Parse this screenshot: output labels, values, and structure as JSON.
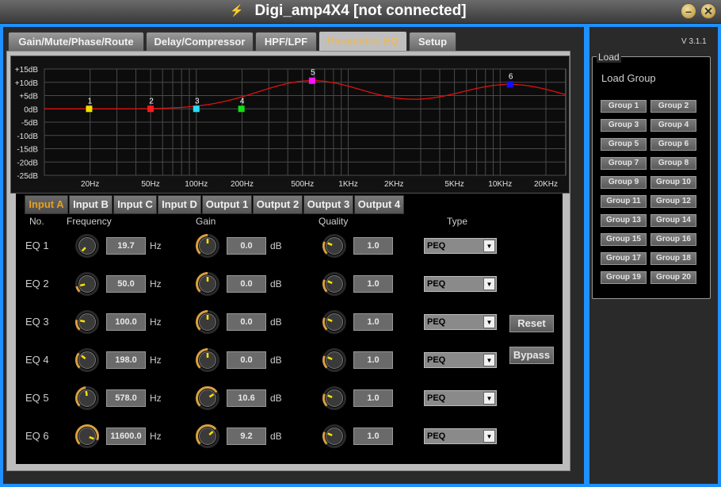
{
  "window": {
    "title": "Digi_amp4X4 [not connected]",
    "minimize_symbol": "–",
    "close_symbol": "✕"
  },
  "version": "V 3.1.1",
  "tabs": [
    {
      "label": "Gain/Mute/Phase/Route",
      "active": false
    },
    {
      "label": "Delay/Compressor",
      "active": false
    },
    {
      "label": "HPF/LPF",
      "active": false
    },
    {
      "label": "Parametric EQ",
      "active": true
    },
    {
      "label": "Setup",
      "active": false
    }
  ],
  "graph": {
    "y_labels": [
      "+15dB",
      "+10dB",
      "+5dB",
      "0dB",
      "-5dB",
      "-10dB",
      "-15dB",
      "-20dB",
      "-25dB"
    ],
    "x_labels": [
      "20Hz",
      "50Hz",
      "100Hz",
      "200Hz",
      "500Hz",
      "1KHz",
      "2KHz",
      "5KHz",
      "10KHz",
      "20KHz"
    ],
    "points": [
      {
        "label": "1",
        "freq": 19.7,
        "gain": 0.0,
        "color": "#f0e000"
      },
      {
        "label": "2",
        "freq": 50.0,
        "gain": 0.0,
        "color": "#ff1a1a"
      },
      {
        "label": "3",
        "freq": 100.0,
        "gain": 0.0,
        "color": "#20e0ff"
      },
      {
        "label": "4",
        "freq": 198.0,
        "gain": 0.0,
        "color": "#10e010"
      },
      {
        "label": "5",
        "freq": 578.0,
        "gain": 10.6,
        "color": "#ff10ff"
      },
      {
        "label": "6",
        "freq": 11600.0,
        "gain": 9.2,
        "color": "#1010ff"
      }
    ],
    "curve_color": "#e01010"
  },
  "channels": [
    {
      "label": "Input A",
      "active": true
    },
    {
      "label": "Input B",
      "active": false
    },
    {
      "label": "Input C",
      "active": false
    },
    {
      "label": "Input D",
      "active": false
    },
    {
      "label": "Output 1",
      "active": false
    },
    {
      "label": "Output 2",
      "active": false
    },
    {
      "label": "Output 3",
      "active": false
    },
    {
      "label": "Output 4",
      "active": false
    }
  ],
  "columns": {
    "no": "No.",
    "frequency": "Frequency",
    "gain": "Gain",
    "quality": "Quality",
    "type": "Type"
  },
  "units": {
    "freq": "Hz",
    "gain": "dB"
  },
  "eq_rows": [
    {
      "no": "EQ 1",
      "freq": "19.7",
      "gain": "0.0",
      "q": "1.0",
      "type": "PEQ"
    },
    {
      "no": "EQ 2",
      "freq": "50.0",
      "gain": "0.0",
      "q": "1.0",
      "type": "PEQ"
    },
    {
      "no": "EQ 3",
      "freq": "100.0",
      "gain": "0.0",
      "q": "1.0",
      "type": "PEQ"
    },
    {
      "no": "EQ 4",
      "freq": "198.0",
      "gain": "0.0",
      "q": "1.0",
      "type": "PEQ"
    },
    {
      "no": "EQ 5",
      "freq": "578.0",
      "gain": "10.6",
      "q": "1.0",
      "type": "PEQ"
    },
    {
      "no": "EQ 6",
      "freq": "11600.0",
      "gain": "9.2",
      "q": "1.0",
      "type": "PEQ"
    }
  ],
  "knob_levels": {
    "freq": [
      0.0,
      0.12,
      0.21,
      0.31,
      0.47,
      0.91
    ],
    "gain": [
      0.5,
      0.5,
      0.5,
      0.5,
      0.71,
      0.68
    ],
    "q": [
      0.25,
      0.25,
      0.25,
      0.25,
      0.25,
      0.25
    ]
  },
  "buttons": {
    "reset": "Reset",
    "bypass": "Bypass"
  },
  "load": {
    "legend": "Load",
    "title": "Load Group",
    "groups": [
      "Group 1",
      "Group 2",
      "Group 3",
      "Group 4",
      "Group 5",
      "Group 6",
      "Group 7",
      "Group 8",
      "Group 9",
      "Group 10",
      "Group 11",
      "Group 12",
      "Group 13",
      "Group 14",
      "Group 15",
      "Group 16",
      "Group 17",
      "Group 18",
      "Group 19",
      "Group 20"
    ]
  }
}
